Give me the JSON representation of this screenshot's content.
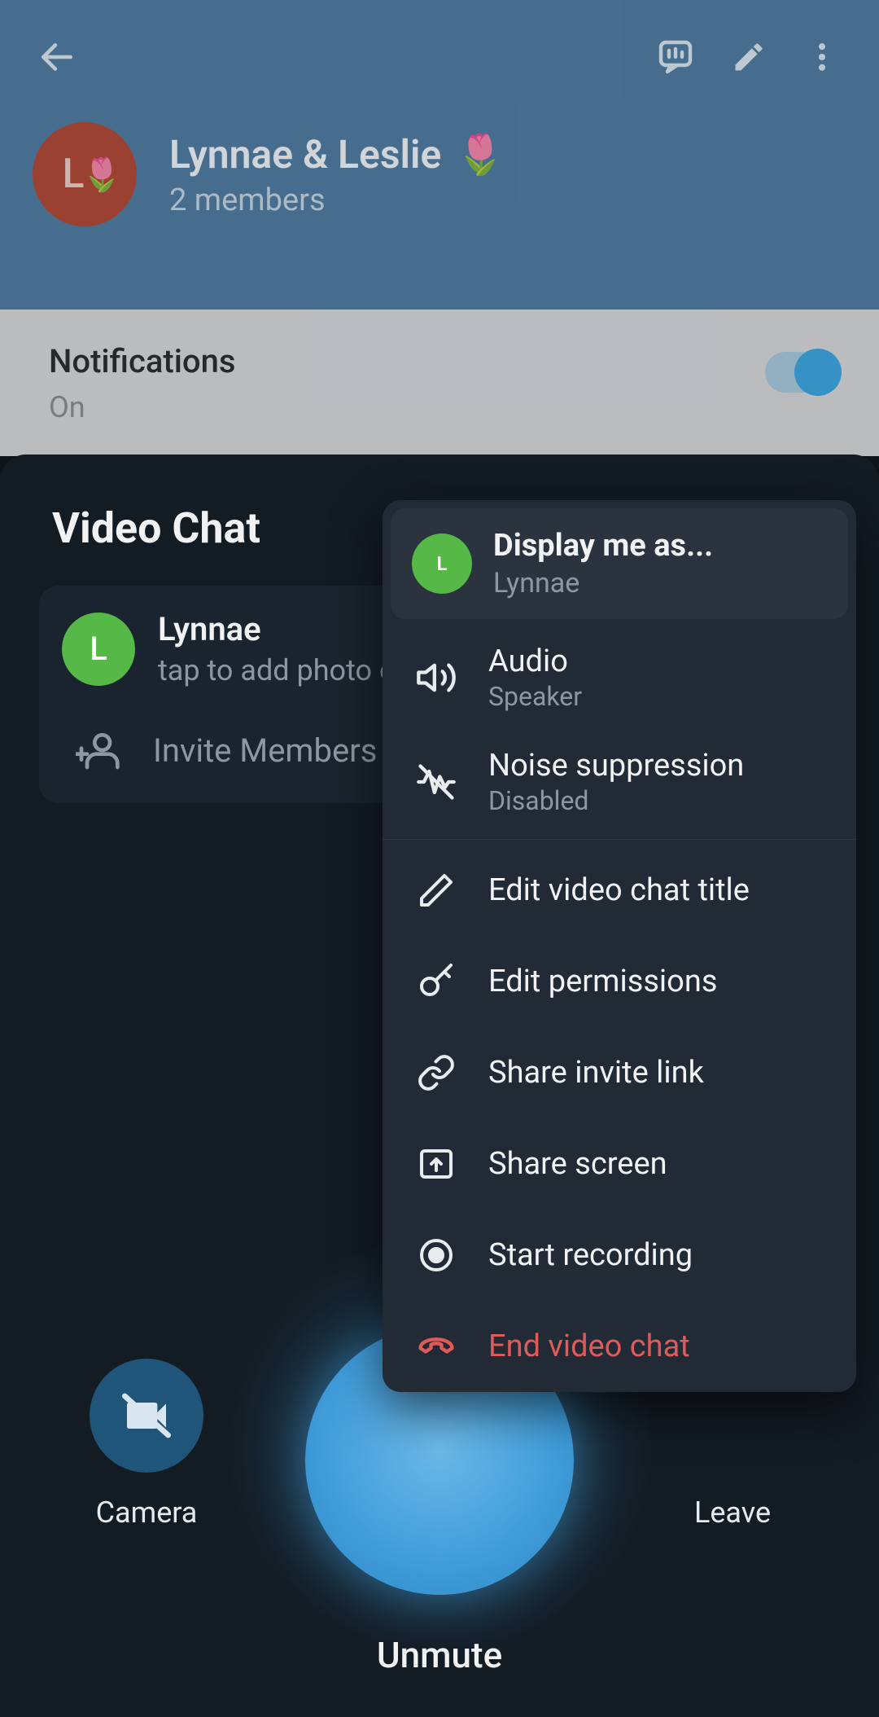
{
  "bg": {
    "title": "Lynnae & Leslie",
    "title_emoji": "🌷",
    "subtitle": "2 members",
    "avatar_letter": "L",
    "avatar_emoji": "🌷",
    "notifications_label": "Notifications",
    "notifications_value": "On"
  },
  "sheet": {
    "title": "Video Chat",
    "participant": {
      "name": "Lynnae",
      "avatar_letter": "L",
      "subtitle": "tap to add photo or bio"
    },
    "invite_label": "Invite Members"
  },
  "controls": {
    "camera_label": "Camera",
    "leave_label": "Leave",
    "unmute_label": "Unmute"
  },
  "menu": {
    "head_title": "Display me as...",
    "head_sub": "Lynnae",
    "head_avatar_letter": "L",
    "items": [
      {
        "icon": "speaker",
        "title": "Audio",
        "sub": "Speaker"
      },
      {
        "icon": "noise",
        "title": "Noise suppression",
        "sub": "Disabled"
      },
      {
        "icon": "pencil",
        "title": "Edit video chat title"
      },
      {
        "icon": "key",
        "title": "Edit permissions"
      },
      {
        "icon": "link",
        "title": "Share invite link"
      },
      {
        "icon": "screen",
        "title": "Share screen"
      },
      {
        "icon": "record",
        "title": "Start recording"
      },
      {
        "icon": "end",
        "title": "End video chat",
        "red": true
      }
    ]
  }
}
